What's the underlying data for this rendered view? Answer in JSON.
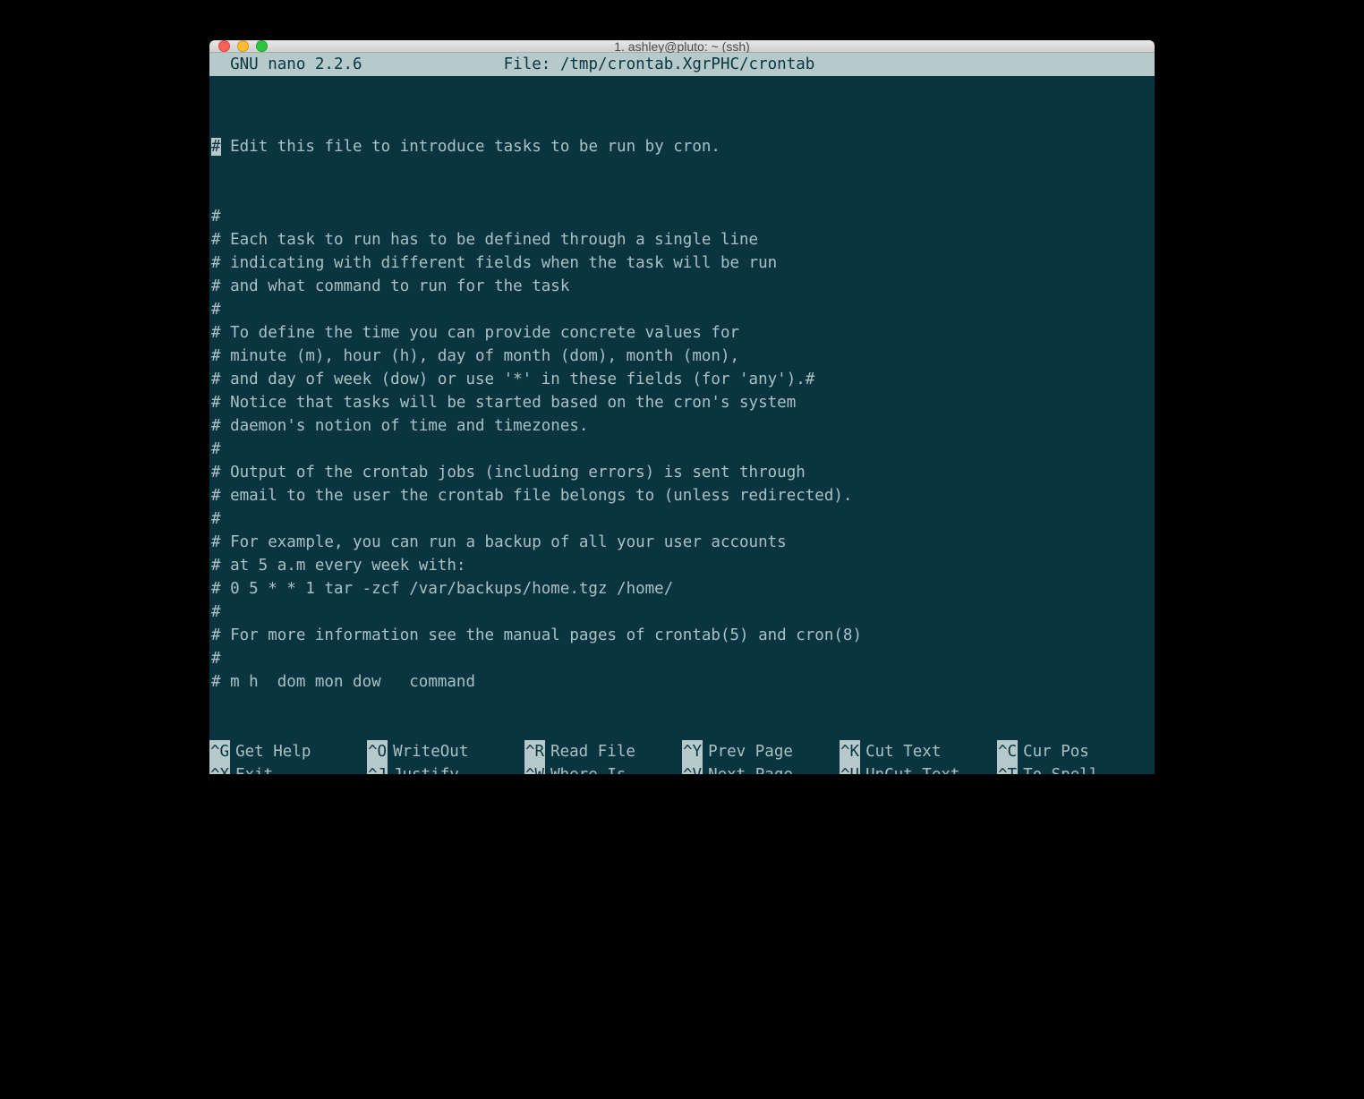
{
  "window": {
    "title": "1. ashley@pluto: ~ (ssh)"
  },
  "nano": {
    "app_label": "  GNU nano 2.2.6",
    "file_label": "File: /tmp/crontab.XgrPHC/crontab",
    "cursor_char": "#",
    "first_line_rest": " Edit this file to introduce tasks to be run by cron.",
    "lines": [
      "#",
      "# Each task to run has to be defined through a single line",
      "# indicating with different fields when the task will be run",
      "# and what command to run for the task",
      "#",
      "# To define the time you can provide concrete values for",
      "# minute (m), hour (h), day of month (dom), month (mon),",
      "# and day of week (dow) or use '*' in these fields (for 'any').#",
      "# Notice that tasks will be started based on the cron's system",
      "# daemon's notion of time and timezones.",
      "#",
      "# Output of the crontab jobs (including errors) is sent through",
      "# email to the user the crontab file belongs to (unless redirected).",
      "#",
      "# For example, you can run a backup of all your user accounts",
      "# at 5 a.m every week with:",
      "# 0 5 * * 1 tar -zcf /var/backups/home.tgz /home/",
      "#",
      "# For more information see the manual pages of crontab(5) and cron(8)",
      "#",
      "# m h  dom mon dow   command"
    ],
    "shortcuts_row1": [
      {
        "key": "^G",
        "label": "Get Help"
      },
      {
        "key": "^O",
        "label": "WriteOut"
      },
      {
        "key": "^R",
        "label": "Read File"
      },
      {
        "key": "^Y",
        "label": "Prev Page"
      },
      {
        "key": "^K",
        "label": "Cut Text"
      },
      {
        "key": "^C",
        "label": "Cur Pos"
      }
    ],
    "shortcuts_row2": [
      {
        "key": "^X",
        "label": "Exit"
      },
      {
        "key": "^J",
        "label": "Justify"
      },
      {
        "key": "^W",
        "label": "Where Is"
      },
      {
        "key": "^V",
        "label": "Next Page"
      },
      {
        "key": "^U",
        "label": "UnCut Text"
      },
      {
        "key": "^T",
        "label": "To Spell"
      }
    ]
  }
}
